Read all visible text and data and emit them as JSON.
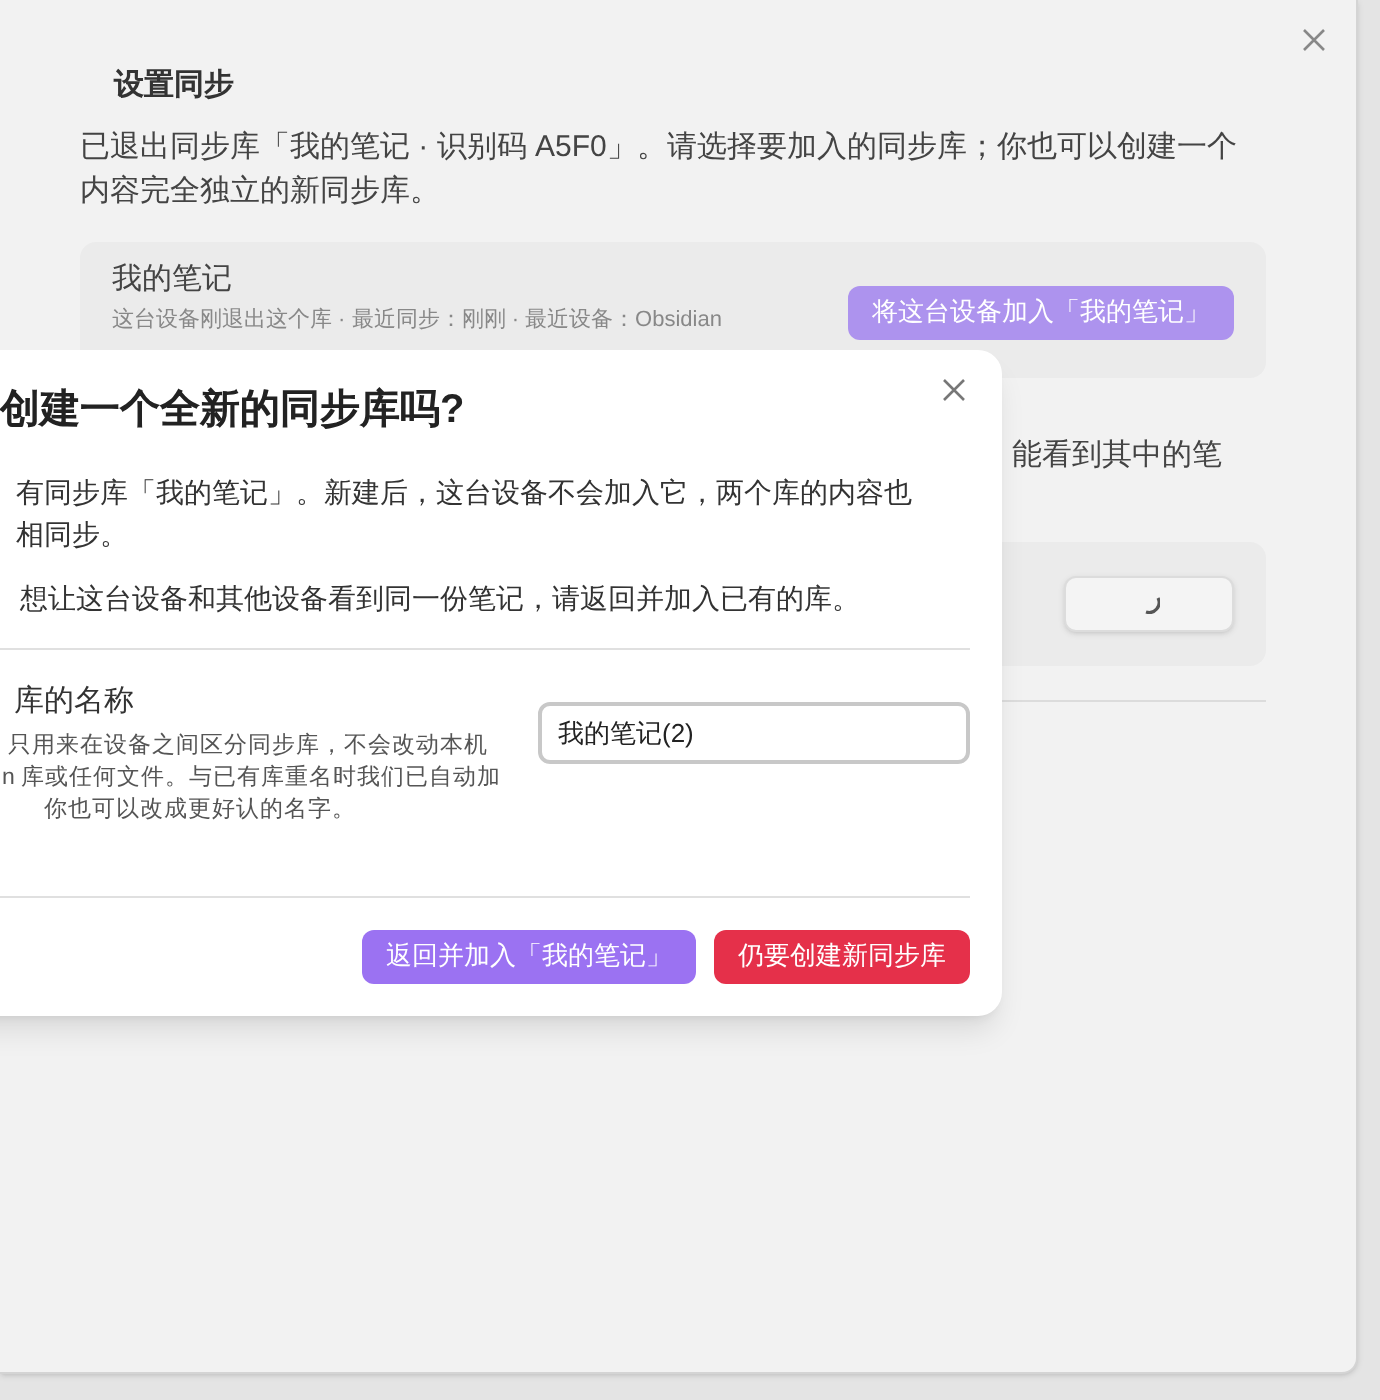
{
  "settings_panel": {
    "title": "设置同步",
    "intro": "已退出同步库「我的笔记 · 识别码 A5F0」。请选择要加入的同步库；你也可以创建一个内容完全独立的新同步库。",
    "vault_card": {
      "name": "我的笔记",
      "meta": "这台设备刚退出这个库 · 最近同步：刚刚 · 最近设备：Obsidian",
      "join_button": "将这台设备加入「我的笔记」"
    },
    "partial_text": "能看到其中的笔",
    "second_card": {
      "button_loading": true
    }
  },
  "dialog": {
    "title": "创建一个全新的同步库吗?",
    "paragraph_1_lines": [
      "有同步库「我的笔记」。新建后，这台设备不会加入它，两个库的内容也",
      "相同步。"
    ],
    "paragraph_2": "想让这台设备和其他设备看到同一份笔记，请返回并加入已有的库。",
    "name_field": {
      "label": "库的名称",
      "help_lines": [
        "只用来在设备之间区分同步库，不会改动本机",
        "n 库或任何文件。与已有库重名时我们已自动加",
        "你也可以改成更好认的名字。"
      ],
      "value": "我的笔记(2)"
    },
    "buttons": [
      {
        "label": "返回并加入「我的笔记」",
        "kind": "secondary"
      },
      {
        "label": "仍要创建新同步库",
        "kind": "danger"
      }
    ]
  }
}
